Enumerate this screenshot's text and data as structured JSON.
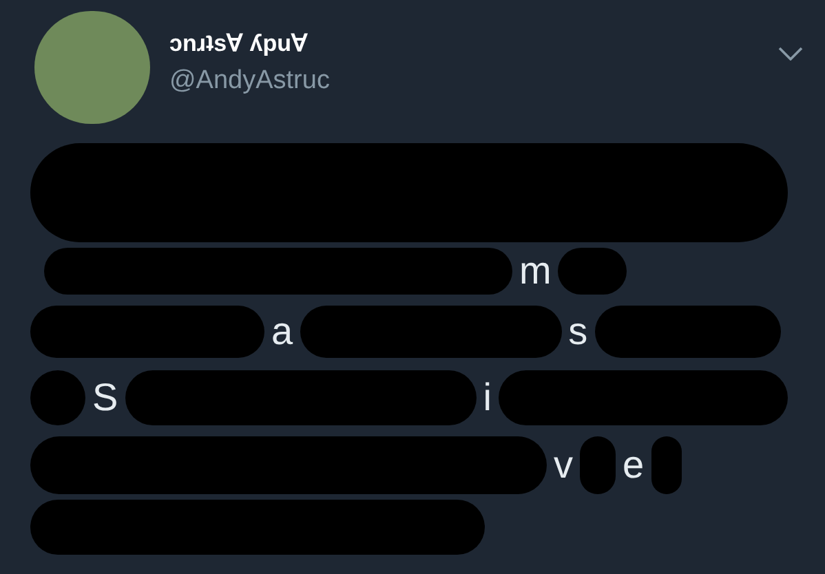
{
  "tweet": {
    "display_name": "ɔnɹʇs∀ ʎpu∀",
    "handle": "@AndyAstruc",
    "body_lines": [
      {
        "segments": [
          {
            "kind": "redacted"
          }
        ]
      },
      {
        "segments": [
          {
            "kind": "redacted"
          },
          {
            "kind": "text",
            "text": "m"
          },
          {
            "kind": "redacted"
          }
        ]
      },
      {
        "segments": [
          {
            "kind": "redacted"
          },
          {
            "kind": "text",
            "text": "a"
          },
          {
            "kind": "redacted"
          },
          {
            "kind": "text",
            "text": "s"
          },
          {
            "kind": "redacted"
          }
        ]
      },
      {
        "segments": [
          {
            "kind": "redacted"
          },
          {
            "kind": "text",
            "text": "S"
          },
          {
            "kind": "redacted"
          },
          {
            "kind": "text",
            "text": "i"
          },
          {
            "kind": "redacted"
          }
        ]
      },
      {
        "segments": [
          {
            "kind": "redacted"
          },
          {
            "kind": "text",
            "text": "v"
          },
          {
            "kind": "redacted"
          },
          {
            "kind": "text",
            "text": "e"
          },
          {
            "kind": "redacted"
          }
        ]
      },
      {
        "segments": [
          {
            "kind": "redacted"
          }
        ]
      }
    ]
  }
}
